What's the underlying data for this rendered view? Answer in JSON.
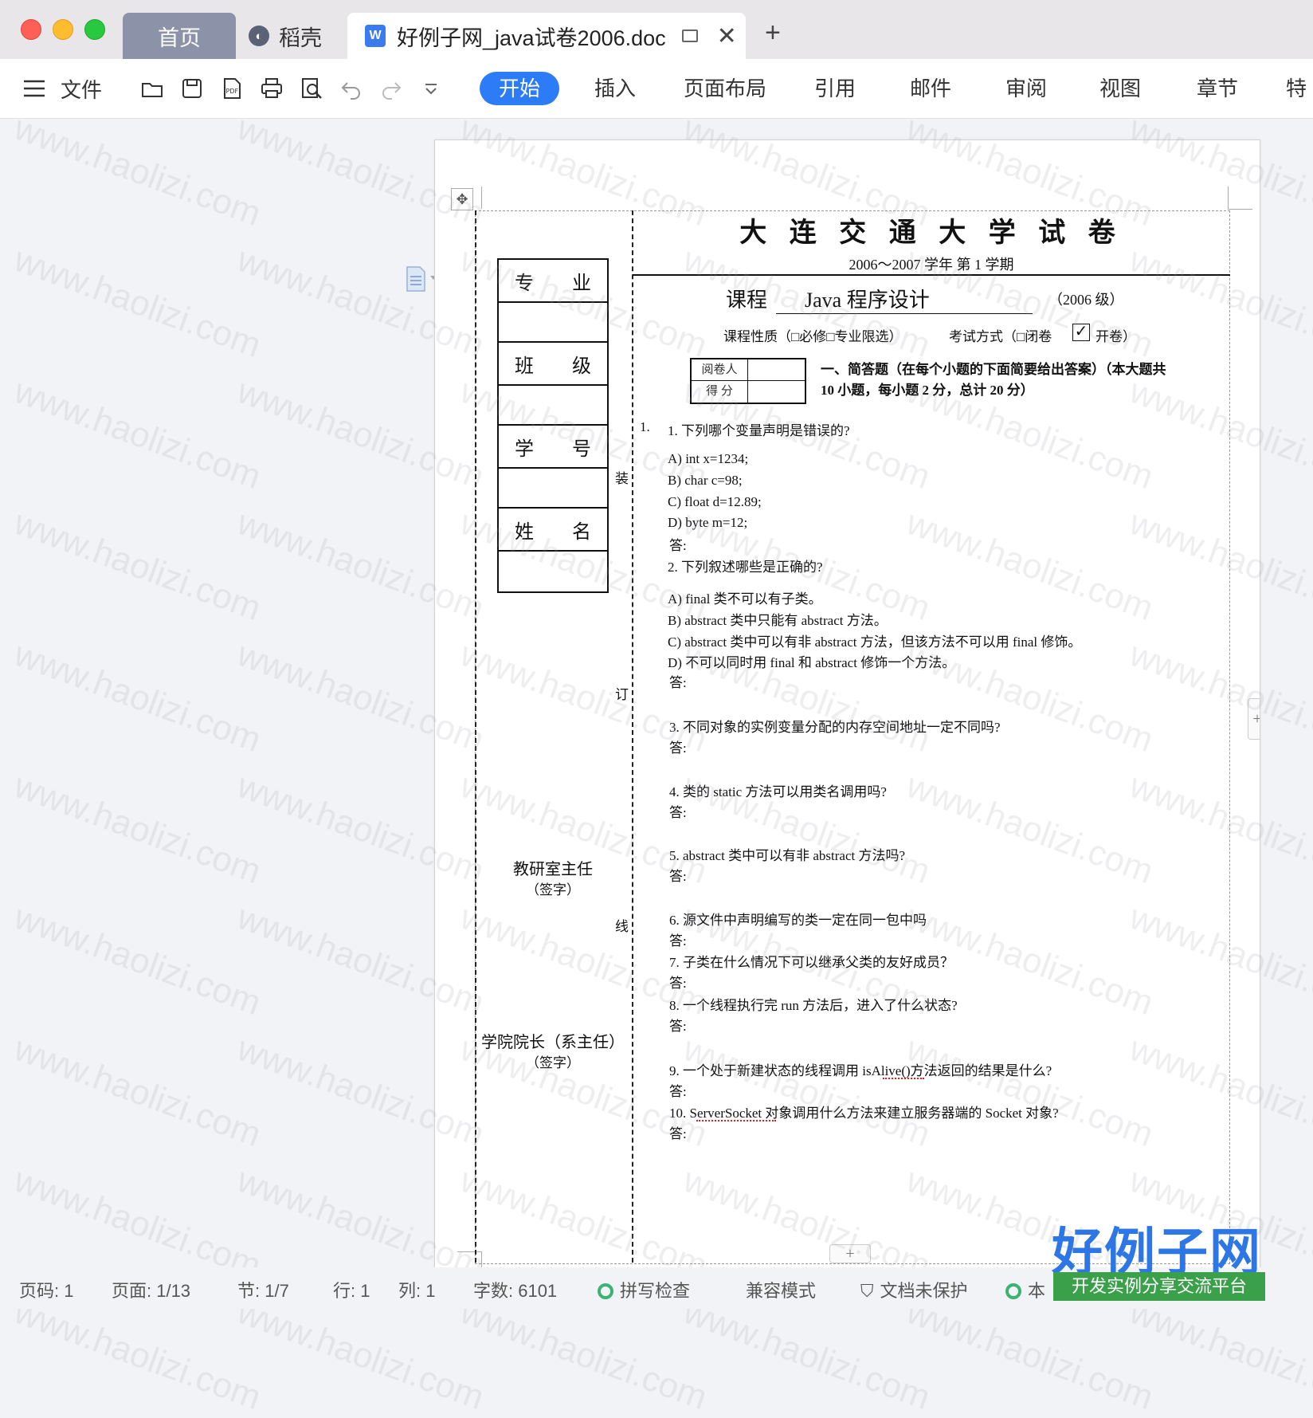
{
  "tabs": {
    "home": "首页",
    "daoke": "稻壳",
    "doc": "好例子网_java试卷2006.doc",
    "new": "+"
  },
  "toolbar": {
    "menu": "文件",
    "ribbon": [
      "开始",
      "插入",
      "页面布局",
      "引用",
      "邮件",
      "审阅",
      "视图",
      "章节",
      "特色"
    ]
  },
  "doc": {
    "univ_title": "大 连 交 通 大 学 试 卷",
    "term": "2006～2007 学年   第 1 学期",
    "course_label": "课程",
    "course_name": "Java 程序设计",
    "grade": "（2006 级）",
    "nature": "课程性质（□必修□专业限选）",
    "exam_mode": "考试方式（□闭卷",
    "open_book": "开卷）",
    "reviewer": "阅卷人",
    "score": "得   分",
    "section1": "一、简答题（在每个小题的下面简要给出答案）（本大题共",
    "section1b": "10 小题，每小题 2 分，总计 20 分）",
    "left_table": [
      {
        "a": "专",
        "b": "业"
      },
      {
        "a": "",
        "b": ""
      },
      {
        "a": "班",
        "b": "级"
      },
      {
        "a": "",
        "b": ""
      },
      {
        "a": "学",
        "b": "号"
      },
      {
        "a": "",
        "b": ""
      },
      {
        "a": "姓",
        "b": "名"
      },
      {
        "a": "",
        "b": ""
      }
    ],
    "binding": [
      "装",
      "订",
      "线"
    ],
    "sign1": "教研室主任",
    "sign1b": "（签字）",
    "sign2": "学院院长（系主任）",
    "sign2b": "（签字）",
    "q_num1": "1.",
    "questions": [
      {
        "text": "1.   下列哪个变量声明是错误的?"
      },
      {
        "text": "A)    int x=1234;"
      },
      {
        "text": "B)    char c=98;"
      },
      {
        "text": "C)    float d=12.89;"
      },
      {
        "text": "D)    byte m=12;"
      },
      {
        "text": "答:"
      },
      {
        "text": "2.   下列叙述哪些是正确的?"
      },
      {
        "text": "A)    final  类不可以有子类。"
      },
      {
        "text": "B)    abstract 类中只能有 abstract 方法。"
      },
      {
        "text": "C)    abstract 类中可以有非 abstract 方法，但该方法不可以用 final 修饰。"
      },
      {
        "text": "D)    不可以同时用 final 和 abstract 修饰一个方法。"
      },
      {
        "text": "答:"
      },
      {
        "text": "3.  不同对象的实例变量分配的内存空间地址一定不同吗?"
      },
      {
        "text": "答:"
      },
      {
        "text": "4.  类的 static 方法可以用类名调用吗?"
      },
      {
        "text": "答:"
      },
      {
        "text": "5.  abstract 类中可以有非 abstract 方法吗?"
      },
      {
        "text": "答:"
      },
      {
        "text": "6.  源文件中声明编写的类一定在同一包中吗"
      },
      {
        "text": "答:"
      },
      {
        "text": "7.  子类在什么情况下可以继承父类的友好成员？"
      },
      {
        "text": "答:"
      },
      {
        "text": "8.  一个线程执行完 run 方法后，进入了什么状态?"
      },
      {
        "text": "答:"
      },
      {
        "text": "9.  一个处于新建状态的线程调用 isAlive()方法返回的结果是什么?"
      },
      {
        "text": "答:"
      },
      {
        "text": "10.  ServerSocket 对象调用什么方法来建立服务器端的 Socket 对象?"
      },
      {
        "text": "答:"
      }
    ]
  },
  "status": {
    "page_code": "页码: 1",
    "page": "页面: 1/13",
    "section": "节: 1/7",
    "row": "行: 1",
    "col": "列: 1",
    "words": "字数: 6101",
    "spell": "拼写检查",
    "compat": "兼容模式",
    "protect": "文档未保护",
    "ben": "本"
  },
  "brand": {
    "logo": "好例子网",
    "slogan": "开发实例分享交流平台"
  },
  "watermark": "www.haolizi.com",
  "colors": {
    "accent": "#2b7cf6",
    "brand_blue": "#2d76e5",
    "brand_green": "#3aa14a"
  }
}
